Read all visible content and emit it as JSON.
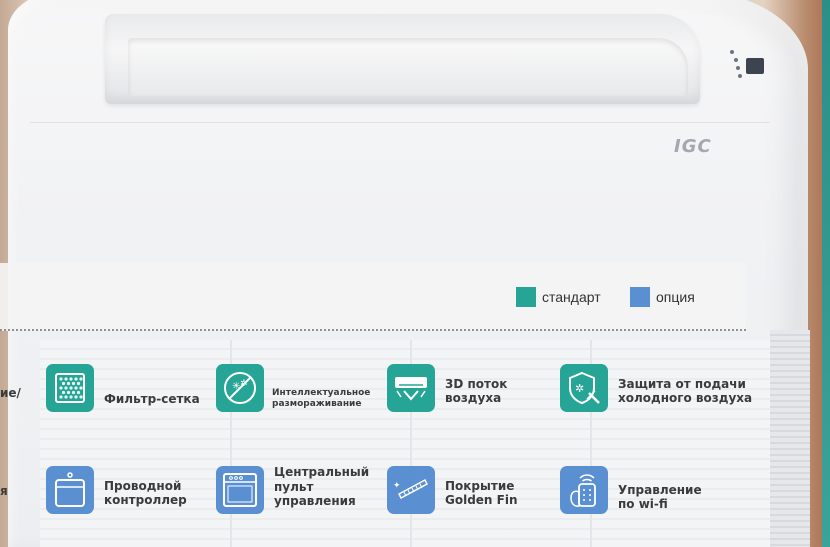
{
  "brand": {
    "logo": "IGC"
  },
  "legend": {
    "standard_label": "стандарт",
    "option_label": "опция",
    "standard_color": "#26a596",
    "option_color": "#5a8fd1"
  },
  "partial_labels": [
    "ие/",
    "я"
  ],
  "features": [
    {
      "label": "Фильтр-сетка",
      "type": "standard",
      "icon": "filter-mesh-icon"
    },
    {
      "label": "Интеллектуальное размораживание",
      "type": "standard",
      "icon": "defrost-icon"
    },
    {
      "label": "3D поток воздуха",
      "type": "standard",
      "icon": "airflow-3d-icon"
    },
    {
      "label": "Защита от подачи холодного воздуха",
      "type": "standard",
      "icon": "cold-air-shield-icon"
    },
    {
      "label": "Проводной контроллер",
      "type": "option",
      "icon": "wired-controller-icon"
    },
    {
      "label": "Центральный пульт управления",
      "type": "option",
      "icon": "central-remote-icon"
    },
    {
      "label": "Покрытие Golden Fin",
      "type": "option",
      "icon": "golden-fin-icon"
    },
    {
      "label": "Управление по wi-fi",
      "type": "option",
      "icon": "wifi-control-icon"
    }
  ]
}
